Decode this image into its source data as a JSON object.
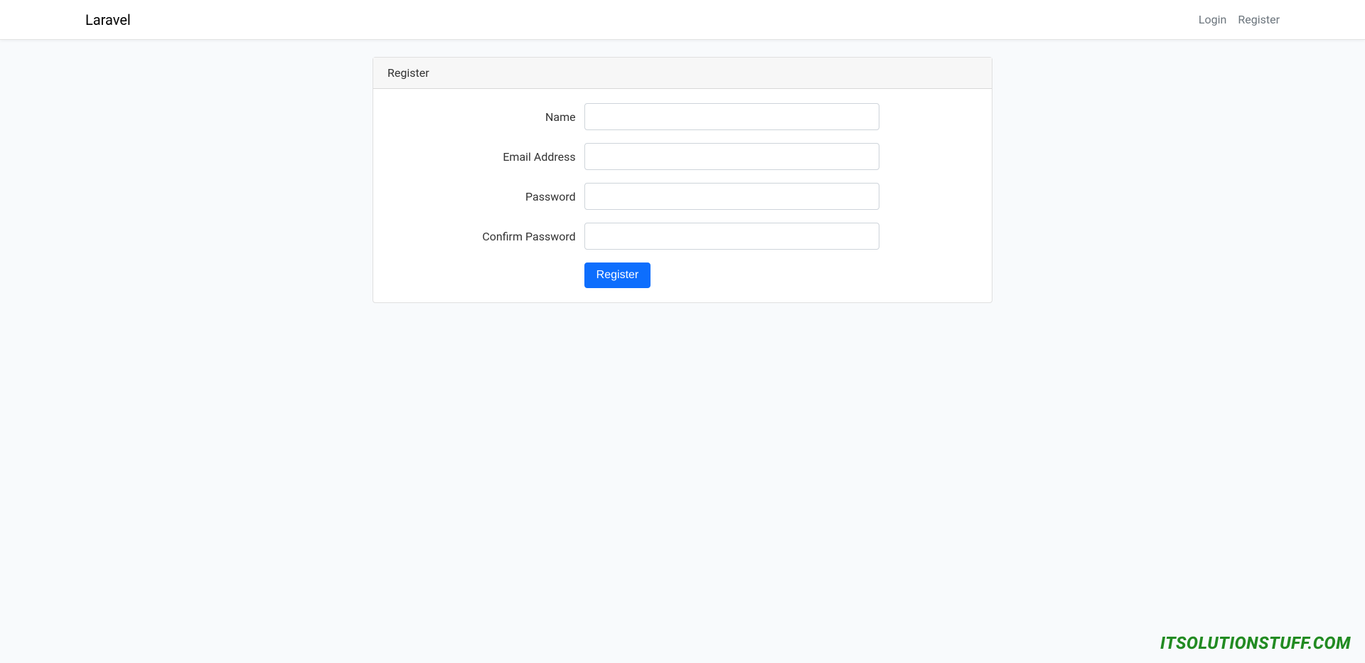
{
  "navbar": {
    "brand": "Laravel",
    "links": {
      "login": "Login",
      "register": "Register"
    }
  },
  "card": {
    "header": "Register"
  },
  "form": {
    "labels": {
      "name": "Name",
      "email": "Email Address",
      "password": "Password",
      "confirm_password": "Confirm Password"
    },
    "submit_label": "Register"
  },
  "watermark": "ITSOLUTIONSTUFF.COM"
}
